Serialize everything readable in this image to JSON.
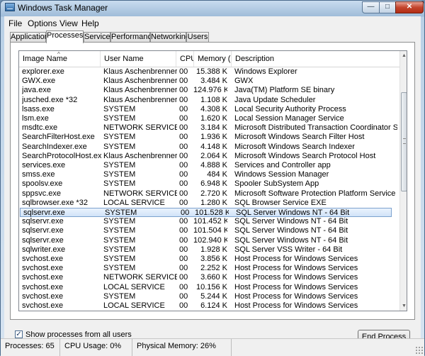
{
  "window": {
    "title": "Windows Task Manager"
  },
  "controls": {
    "minimize": "—",
    "maximize": "□",
    "close": "✕"
  },
  "menu": {
    "file": "File",
    "options": "Options",
    "view": "View",
    "help": "Help"
  },
  "tabs": [
    {
      "label": "Applications"
    },
    {
      "label": "Processes"
    },
    {
      "label": "Services"
    },
    {
      "label": "Performance"
    },
    {
      "label": "Networking"
    },
    {
      "label": "Users"
    }
  ],
  "active_tab": "Processes",
  "columns": {
    "name": "Image Name",
    "user": "User Name",
    "cpu": "CPU",
    "mem": "Memory (...",
    "desc": "Description",
    "sort_glyph": "^"
  },
  "processes": [
    {
      "name": "explorer.exe",
      "user": "Klaus Aschenbrenner",
      "cpu": "00",
      "mem": "15.388 K",
      "desc": "Windows Explorer"
    },
    {
      "name": "GWX.exe",
      "user": "Klaus Aschenbrenner",
      "cpu": "00",
      "mem": "3.484 K",
      "desc": "GWX"
    },
    {
      "name": "java.exe",
      "user": "Klaus Aschenbrenner",
      "cpu": "00",
      "mem": "124.976 K",
      "desc": "Java(TM) Platform SE binary"
    },
    {
      "name": "jusched.exe *32",
      "user": "Klaus Aschenbrenner",
      "cpu": "00",
      "mem": "1.108 K",
      "desc": "Java Update Scheduler"
    },
    {
      "name": "lsass.exe",
      "user": "SYSTEM",
      "cpu": "00",
      "mem": "4.308 K",
      "desc": "Local Security Authority Process"
    },
    {
      "name": "lsm.exe",
      "user": "SYSTEM",
      "cpu": "00",
      "mem": "1.620 K",
      "desc": "Local Session Manager Service"
    },
    {
      "name": "msdtc.exe",
      "user": "NETWORK SERVICE",
      "cpu": "00",
      "mem": "3.184 K",
      "desc": "Microsoft Distributed Transaction Coordinator Service"
    },
    {
      "name": "SearchFilterHost.exe",
      "user": "SYSTEM",
      "cpu": "00",
      "mem": "1.936 K",
      "desc": "Microsoft Windows Search Filter Host"
    },
    {
      "name": "SearchIndexer.exe",
      "user": "SYSTEM",
      "cpu": "00",
      "mem": "4.148 K",
      "desc": "Microsoft Windows Search Indexer"
    },
    {
      "name": "SearchProtocolHost.exe",
      "user": "Klaus Aschenbrenner",
      "cpu": "00",
      "mem": "2.064 K",
      "desc": "Microsoft Windows Search Protocol Host"
    },
    {
      "name": "services.exe",
      "user": "SYSTEM",
      "cpu": "00",
      "mem": "4.888 K",
      "desc": "Services and Controller app"
    },
    {
      "name": "smss.exe",
      "user": "SYSTEM",
      "cpu": "00",
      "mem": "484 K",
      "desc": "Windows Session Manager"
    },
    {
      "name": "spoolsv.exe",
      "user": "SYSTEM",
      "cpu": "00",
      "mem": "6.948 K",
      "desc": "Spooler SubSystem App"
    },
    {
      "name": "sppsvc.exe",
      "user": "NETWORK SERVICE",
      "cpu": "00",
      "mem": "2.720 K",
      "desc": "Microsoft Software Protection Platform Service"
    },
    {
      "name": "sqlbrowser.exe *32",
      "user": "LOCAL SERVICE",
      "cpu": "00",
      "mem": "1.280 K",
      "desc": "SQL Browser Service EXE"
    },
    {
      "name": "sqlservr.exe",
      "user": "SYSTEM",
      "cpu": "00",
      "mem": "101.528 K",
      "desc": "SQL Server Windows NT - 64 Bit",
      "selected": true
    },
    {
      "name": "sqlservr.exe",
      "user": "SYSTEM",
      "cpu": "00",
      "mem": "101.452 K",
      "desc": "SQL Server Windows NT - 64 Bit"
    },
    {
      "name": "sqlservr.exe",
      "user": "SYSTEM",
      "cpu": "00",
      "mem": "101.504 K",
      "desc": "SQL Server Windows NT - 64 Bit"
    },
    {
      "name": "sqlservr.exe",
      "user": "SYSTEM",
      "cpu": "00",
      "mem": "102.940 K",
      "desc": "SQL Server Windows NT - 64 Bit"
    },
    {
      "name": "sqlwriter.exe",
      "user": "SYSTEM",
      "cpu": "00",
      "mem": "1.928 K",
      "desc": "SQL Server VSS Writer - 64 Bit"
    },
    {
      "name": "svchost.exe",
      "user": "SYSTEM",
      "cpu": "00",
      "mem": "3.856 K",
      "desc": "Host Process for Windows Services"
    },
    {
      "name": "svchost.exe",
      "user": "SYSTEM",
      "cpu": "00",
      "mem": "2.252 K",
      "desc": "Host Process for Windows Services"
    },
    {
      "name": "svchost.exe",
      "user": "NETWORK SERVICE",
      "cpu": "00",
      "mem": "3.660 K",
      "desc": "Host Process for Windows Services"
    },
    {
      "name": "svchost.exe",
      "user": "LOCAL SERVICE",
      "cpu": "00",
      "mem": "10.156 K",
      "desc": "Host Process for Windows Services"
    },
    {
      "name": "svchost.exe",
      "user": "SYSTEM",
      "cpu": "00",
      "mem": "5.244 K",
      "desc": "Host Process for Windows Services"
    },
    {
      "name": "svchost.exe",
      "user": "LOCAL SERVICE",
      "cpu": "00",
      "mem": "6.124 K",
      "desc": "Host Process for Windows Services"
    }
  ],
  "scrollbar": {
    "up": "▲",
    "down": "▼"
  },
  "options": {
    "show_all_label": "Show processes from all users",
    "show_all_checked": true,
    "check_glyph": "✓"
  },
  "buttons": {
    "end_process": "End Process"
  },
  "status": {
    "processes": "Processes: 65",
    "cpu": "CPU Usage: 0%",
    "memory": "Physical Memory: 26%"
  }
}
